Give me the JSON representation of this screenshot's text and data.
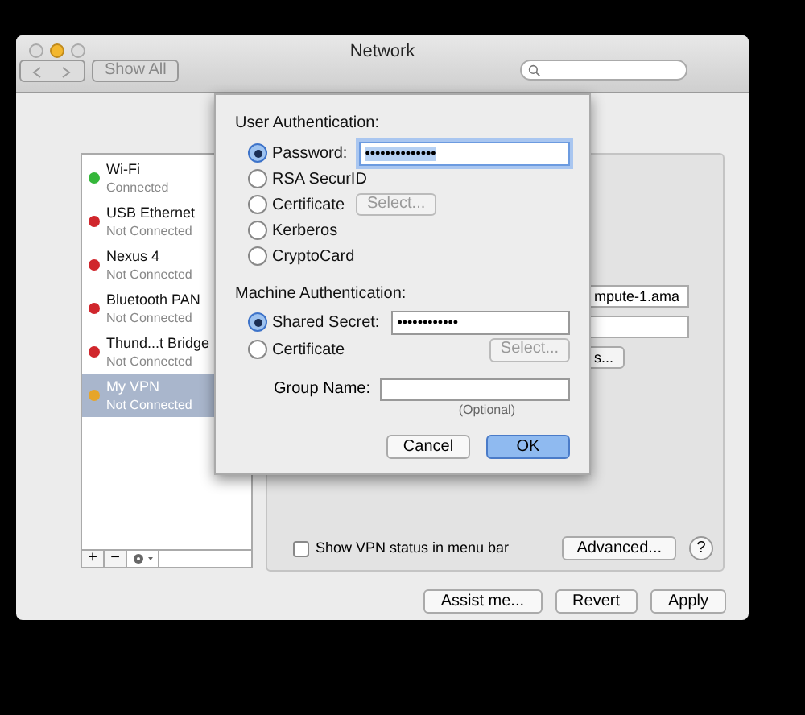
{
  "window": {
    "title": "Network"
  },
  "toolbar": {
    "show_all": "Show All"
  },
  "sidebar": {
    "items": [
      {
        "name": "Wi-Fi",
        "status": "Connected",
        "color": "#35b73a",
        "selected": false
      },
      {
        "name": "USB Ethernet",
        "status": "Not Connected",
        "color": "#d0262c",
        "selected": false
      },
      {
        "name": "Nexus 4",
        "status": "Not Connected",
        "color": "#d0262c",
        "selected": false
      },
      {
        "name": "Bluetooth PAN",
        "status": "Not Connected",
        "color": "#d0262c",
        "selected": false
      },
      {
        "name": "Thund...t Bridge",
        "status": "Not Connected",
        "color": "#d0262c",
        "selected": false
      },
      {
        "name": "My VPN",
        "status": "Not Connected",
        "color": "#e6a52a",
        "selected": true
      }
    ],
    "buttons": [
      "+",
      "−"
    ]
  },
  "panel": {
    "server_field": "mpute-1.ama",
    "auth_button": "s...",
    "show_status": {
      "label": "Show VPN status in menu bar",
      "checked": false
    },
    "advanced": "Advanced...",
    "help": "?"
  },
  "footer": {
    "buttons": [
      "Assist me...",
      "Revert",
      "Apply"
    ]
  },
  "sheet": {
    "user_heading": "User Authentication:",
    "user_options": [
      {
        "label": "Password:",
        "selected": true,
        "kind": "field",
        "value": "••••••••••••••"
      },
      {
        "label": "RSA SecurID",
        "selected": false,
        "kind": "plain"
      },
      {
        "label": "Certificate",
        "selected": false,
        "kind": "button",
        "button": "Select..."
      },
      {
        "label": "Kerberos",
        "selected": false,
        "kind": "plain"
      },
      {
        "label": "CryptoCard",
        "selected": false,
        "kind": "plain"
      }
    ],
    "machine_heading": "Machine Authentication:",
    "machine_options": [
      {
        "label": "Shared Secret:",
        "selected": true,
        "kind": "field",
        "value": "••••••••••••"
      },
      {
        "label": "Certificate",
        "selected": false,
        "kind": "wide_button",
        "button": "Select..."
      }
    ],
    "group_label": "Group Name:",
    "group_hint": "(Optional)",
    "cancel": "Cancel",
    "ok": "OK"
  }
}
